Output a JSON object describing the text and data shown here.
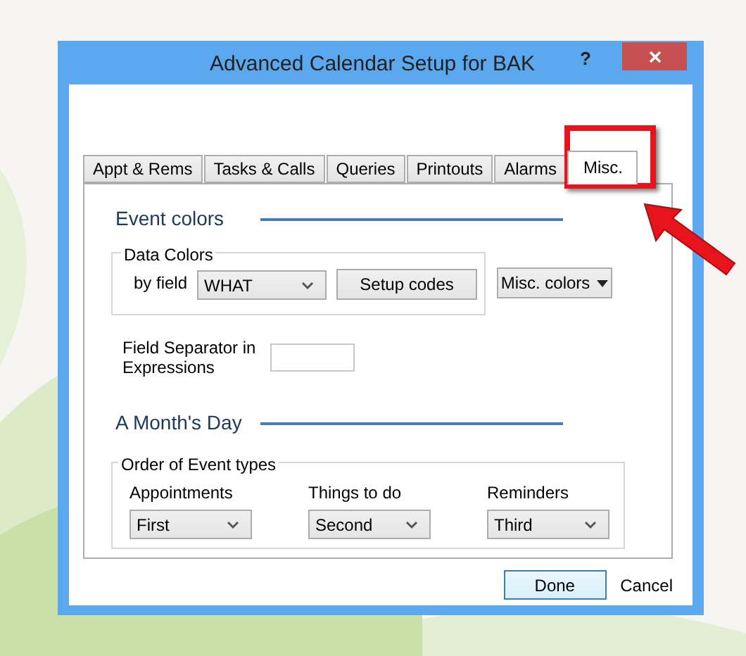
{
  "window": {
    "title": "Advanced Calendar Setup for BAK",
    "help": "?"
  },
  "tabs": [
    {
      "label": "Appt & Rems",
      "selected": false
    },
    {
      "label": "Tasks & Calls",
      "selected": false
    },
    {
      "label": "Queries",
      "selected": false
    },
    {
      "label": "Printouts",
      "selected": false
    },
    {
      "label": "Alarms",
      "selected": false
    },
    {
      "label": "Misc.",
      "selected": true
    }
  ],
  "event_colors": {
    "heading": "Event colors",
    "data_colors": {
      "legend": "Data Colors",
      "by_field_label": "by field",
      "by_field_value": "WHAT",
      "setup_button": "Setup codes"
    },
    "misc_colors_button": "Misc. colors"
  },
  "field_separator": {
    "label": "Field Separator in Expressions"
  },
  "months_day": {
    "heading": "A Month's Day",
    "order": {
      "legend": "Order of Event types",
      "columns": [
        {
          "label": "Appointments",
          "value": "First"
        },
        {
          "label": "Things to do",
          "value": "Second"
        },
        {
          "label": "Reminders",
          "value": "Third"
        }
      ]
    }
  },
  "buttons": {
    "done": "Done",
    "cancel": "Cancel"
  }
}
